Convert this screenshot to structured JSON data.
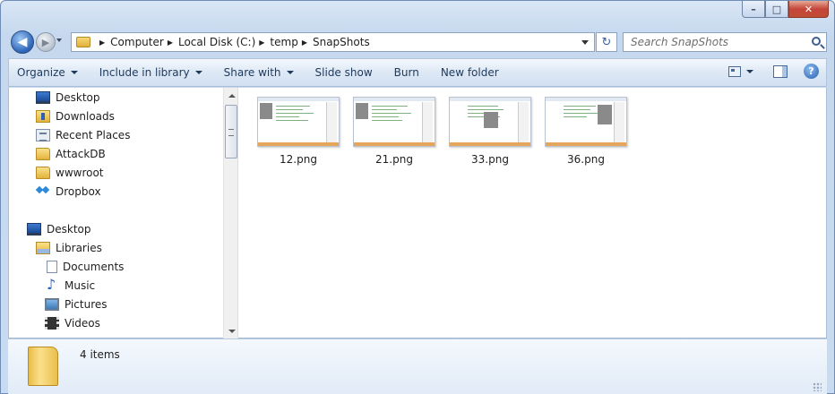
{
  "window": {
    "caption_buttons": [
      "–",
      "□",
      "✕"
    ]
  },
  "nav": {
    "back_glyph": "◀",
    "forward_glyph": "▶"
  },
  "address": {
    "crumbs": [
      "Computer",
      "Local Disk (C:)",
      "temp",
      "SnapShots"
    ],
    "refresh_glyph": "↻"
  },
  "search": {
    "placeholder": "Search SnapShots"
  },
  "toolbar": {
    "items": [
      {
        "label": "Organize",
        "dropdown": true
      },
      {
        "label": "Include in library",
        "dropdown": true
      },
      {
        "label": "Share with",
        "dropdown": true
      },
      {
        "label": "Slide show",
        "dropdown": false
      },
      {
        "label": "Burn",
        "dropdown": false
      },
      {
        "label": "New folder",
        "dropdown": false
      }
    ],
    "help_glyph": "?"
  },
  "sidebar": {
    "favorites": [
      {
        "label": "Desktop",
        "icon": "desktop-icon"
      },
      {
        "label": "Downloads",
        "icon": "downloads-icon"
      },
      {
        "label": "Recent Places",
        "icon": "recent-places-icon"
      },
      {
        "label": "AttackDB",
        "icon": "folder-icon"
      },
      {
        "label": "wwwroot",
        "icon": "folder-icon"
      },
      {
        "label": "Dropbox",
        "icon": "dropbox-icon"
      }
    ],
    "tree": [
      {
        "label": "Desktop",
        "icon": "desktop-icon"
      },
      {
        "label": "Libraries",
        "icon": "libraries-icon"
      },
      {
        "label": "Documents",
        "icon": "documents-icon"
      },
      {
        "label": "Music",
        "icon": "music-icon"
      },
      {
        "label": "Pictures",
        "icon": "pictures-icon"
      },
      {
        "label": "Videos",
        "icon": "videos-icon"
      }
    ]
  },
  "files": [
    {
      "name": "12.png"
    },
    {
      "name": "21.png"
    },
    {
      "name": "33.png"
    },
    {
      "name": "36.png"
    }
  ],
  "details": {
    "item_count": "4 items"
  },
  "colors": {
    "frame": "#c5d8ee",
    "close_button": "#c4463a",
    "accent": "#1e395b"
  }
}
